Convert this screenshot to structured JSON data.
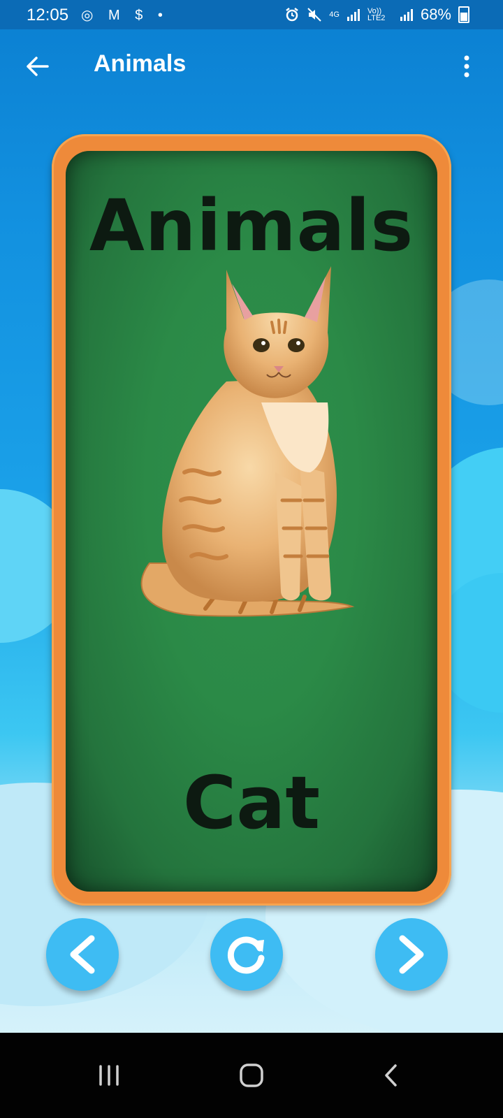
{
  "status_bar": {
    "time": "12:05",
    "left_icons": [
      "instagram-icon",
      "gmail-icon",
      "dollar-icon",
      "dot-icon"
    ],
    "left_glyphs": "◎ M $ •",
    "network_4g": "4G",
    "volte": "Vo)) LTE2",
    "battery": "68%"
  },
  "app_bar": {
    "title": "Animals",
    "back_icon": "arrow-left-icon",
    "menu_icon": "more-vertical-icon"
  },
  "card": {
    "heading": "Animals",
    "word": "Cat",
    "image": "cat-image"
  },
  "controls": {
    "prev_icon": "chevron-left-icon",
    "repeat_icon": "refresh-icon",
    "next_icon": "chevron-right-icon"
  },
  "colors": {
    "card_frame": "#ee8a3a",
    "card_board": "#2b8a47",
    "button": "#3ebcf3",
    "sky": "#1290df"
  }
}
